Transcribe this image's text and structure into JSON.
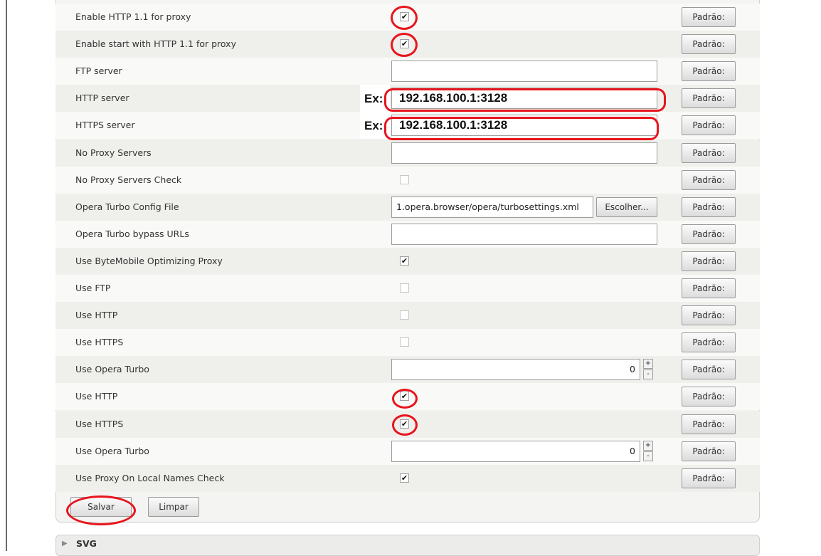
{
  "default_button_label": "Padrão:",
  "example_label": "Ex:",
  "settings": [
    {
      "label": "Enable HTTP 1.1 for proxy",
      "type": "checkbox",
      "checked": true
    },
    {
      "label": "Enable start with HTTP 1.1 for proxy",
      "type": "checkbox",
      "checked": true
    },
    {
      "label": "FTP server",
      "type": "text",
      "value": ""
    },
    {
      "label": "HTTP server",
      "type": "text",
      "value": "192.168.100.1:3128"
    },
    {
      "label": "HTTPS server",
      "type": "text",
      "value": "192.168.100.1:3128"
    },
    {
      "label": "No Proxy Servers",
      "type": "text",
      "value": ""
    },
    {
      "label": "No Proxy Servers Check",
      "type": "checkbox",
      "checked": false
    },
    {
      "label": "Opera Turbo Config File",
      "type": "file",
      "value": "‪1.opera.browser/opera/turbosettings.xml",
      "button": "Escolher..."
    },
    {
      "label": "Opera Turbo bypass URLs",
      "type": "text",
      "value": ""
    },
    {
      "label": "Use ByteMobile Optimizing Proxy",
      "type": "checkbox",
      "checked": true
    },
    {
      "label": "Use FTP",
      "type": "checkbox",
      "checked": false
    },
    {
      "label": "Use HTTP",
      "type": "checkbox",
      "checked": false
    },
    {
      "label": "Use HTTPS",
      "type": "checkbox",
      "checked": false
    },
    {
      "label": "Use Opera Turbo",
      "type": "number",
      "value": "0"
    },
    {
      "label": "Use HTTP",
      "type": "checkbox",
      "checked": true
    },
    {
      "label": "Use HTTPS",
      "type": "checkbox",
      "checked": true
    },
    {
      "label": "Use Opera Turbo",
      "type": "number",
      "value": "0"
    },
    {
      "label": "Use Proxy On Local Names Check",
      "type": "checkbox",
      "checked": true
    }
  ],
  "footer": {
    "save_label": "Salvar",
    "clear_label": "Limpar"
  },
  "next_section": {
    "title": "SVG"
  },
  "icons": {
    "checked": "checkmark-icon",
    "spin_up": "plus-icon",
    "spin_down": "minus-icon",
    "collapsed": "triangle-right-icon"
  },
  "annotation_color": "#e8141c"
}
